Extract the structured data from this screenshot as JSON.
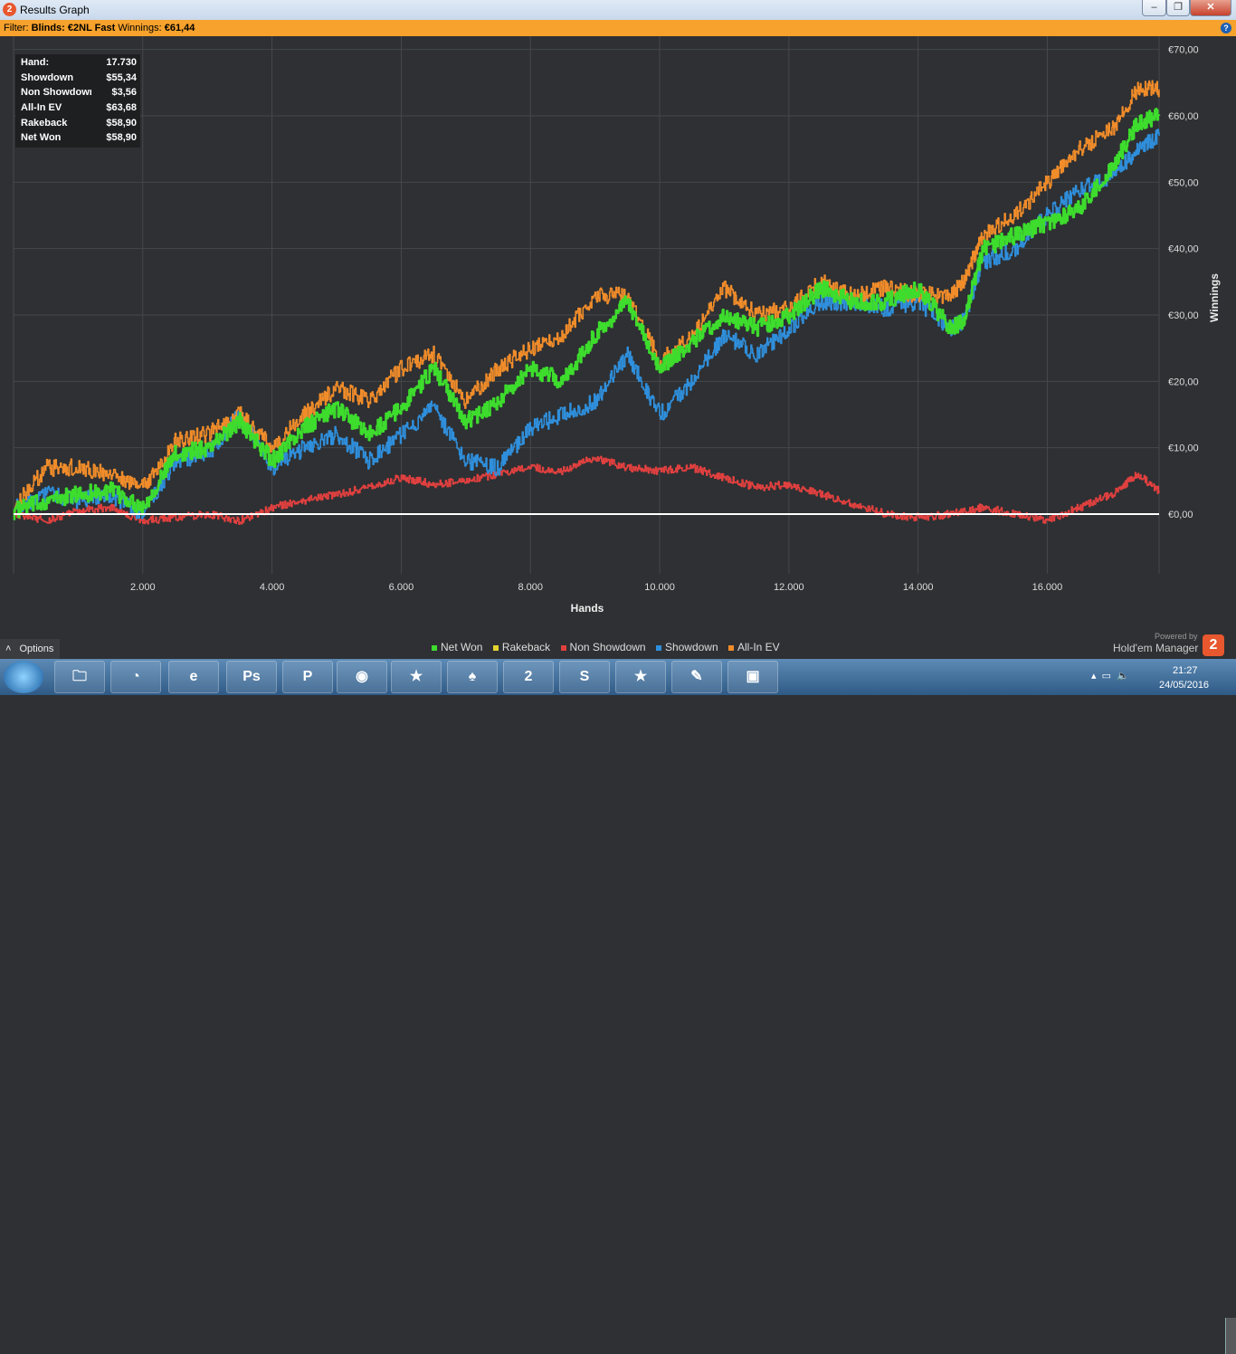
{
  "window": {
    "title": "Results Graph",
    "app_icon_text": "2",
    "controls": {
      "min": "–",
      "max": "❐",
      "close": "✕"
    }
  },
  "filter": {
    "prefix": "Filter:",
    "blinds": "Blinds: €2NL Fast",
    "winnings_label": "Winnings:",
    "winnings_value": "€61,44",
    "help": "?"
  },
  "stats": [
    {
      "label": "Hand:",
      "value": "17.730"
    },
    {
      "label": "Showdown",
      "value": "$55,34"
    },
    {
      "label": "Non Showdown",
      "value": "$3,56"
    },
    {
      "label": "All-In EV",
      "value": "$63,68"
    },
    {
      "label": "Rakeback",
      "value": "$58,90"
    },
    {
      "label": "Net Won",
      "value": "$58,90"
    }
  ],
  "colors": {
    "background": "#2e3033",
    "grid": "#45484c",
    "net_won": "#3ddc2d",
    "rakeback": "#e3d330",
    "non_showdown": "#e0403f",
    "showdown": "#2f8fdc",
    "all_in_ev": "#f08c2a",
    "zero_line": "#ffffff"
  },
  "chart_data": {
    "type": "line",
    "xlabel": "Hands",
    "ylabel": "Winnings",
    "xlim": [
      0,
      17730
    ],
    "ylim": [
      -9,
      72
    ],
    "x_ticks": [
      {
        "v": 2000,
        "label": "2.000"
      },
      {
        "v": 4000,
        "label": "4.000"
      },
      {
        "v": 6000,
        "label": "6.000"
      },
      {
        "v": 8000,
        "label": "8.000"
      },
      {
        "v": 10000,
        "label": "10.000"
      },
      {
        "v": 12000,
        "label": "12.000"
      },
      {
        "v": 14000,
        "label": "14.000"
      },
      {
        "v": 16000,
        "label": "16.000"
      }
    ],
    "y_ticks": [
      {
        "v": 0,
        "label": "€0,00"
      },
      {
        "v": 10,
        "label": "€10,00"
      },
      {
        "v": 20,
        "label": "€20,00"
      },
      {
        "v": 30,
        "label": "€30,00"
      },
      {
        "v": 40,
        "label": "€40,00"
      },
      {
        "v": 50,
        "label": "€50,00"
      },
      {
        "v": 60,
        "label": "€60,00"
      },
      {
        "v": 70,
        "label": "€70,00"
      }
    ],
    "grid": true,
    "series": [
      {
        "name": "Net Won",
        "color": "#3ddc2d",
        "x": [
          0,
          500,
          1000,
          1500,
          2000,
          2500,
          3000,
          3500,
          4000,
          4500,
          5000,
          5500,
          6000,
          6500,
          7000,
          7500,
          8000,
          8500,
          9000,
          9500,
          10000,
          10500,
          11000,
          11500,
          12000,
          12500,
          13000,
          13500,
          14000,
          14500,
          14700,
          15000,
          15500,
          16000,
          16500,
          17000,
          17400,
          17730
        ],
        "y": [
          0.5,
          2,
          3,
          3.5,
          1,
          9,
          10,
          14,
          8,
          13,
          16,
          12,
          16,
          22,
          14,
          17,
          22,
          20,
          27,
          32,
          22,
          26,
          30,
          28,
          30,
          34,
          32,
          32,
          34,
          28,
          29,
          40,
          42,
          44,
          46,
          52,
          59,
          60
        ]
      },
      {
        "name": "Rakeback",
        "color": "#e3d330",
        "x": [
          0,
          17730
        ],
        "y": [
          0,
          0
        ]
      },
      {
        "name": "Non Showdown",
        "color": "#e0403f",
        "x": [
          0,
          500,
          1000,
          1500,
          2000,
          2500,
          3000,
          3500,
          4000,
          4500,
          5000,
          5500,
          6000,
          6500,
          7000,
          7500,
          8000,
          8500,
          9000,
          9500,
          10000,
          10500,
          11000,
          11500,
          12000,
          12500,
          13000,
          13500,
          14000,
          14500,
          15000,
          15500,
          16000,
          16500,
          17000,
          17400,
          17730
        ],
        "y": [
          0,
          -1,
          0.5,
          1,
          -1,
          -0.5,
          0,
          -1,
          1,
          2,
          3,
          4,
          5.5,
          4.5,
          5,
          6,
          7,
          6.5,
          8.5,
          7,
          6.5,
          7,
          5.5,
          4,
          4.5,
          3,
          1.5,
          0,
          -0.5,
          0,
          1,
          0,
          -1,
          1,
          3,
          6,
          3.5
        ]
      },
      {
        "name": "Showdown",
        "color": "#2f8fdc",
        "x": [
          0,
          500,
          1000,
          1500,
          2000,
          2500,
          3000,
          3500,
          4000,
          4500,
          5000,
          5500,
          6000,
          6500,
          7000,
          7500,
          8000,
          8500,
          9000,
          9500,
          10000,
          10500,
          11000,
          11500,
          12000,
          12500,
          13000,
          13500,
          14000,
          14500,
          14700,
          15000,
          15500,
          16000,
          16500,
          17000,
          17400,
          17730
        ],
        "y": [
          1,
          3,
          2,
          3,
          0,
          8,
          9,
          15,
          7,
          10,
          12,
          8,
          12,
          16,
          8,
          7,
          13,
          15,
          17,
          24,
          15,
          20,
          27,
          24,
          28,
          32,
          32,
          31,
          32,
          28,
          29,
          38,
          40,
          45,
          49,
          51,
          55,
          57
        ]
      },
      {
        "name": "All-In EV",
        "color": "#f08c2a",
        "x": [
          0,
          500,
          1000,
          1500,
          2000,
          2500,
          3000,
          3500,
          4000,
          4500,
          5000,
          5500,
          6000,
          6500,
          7000,
          7500,
          8000,
          8500,
          9000,
          9500,
          10000,
          10500,
          11000,
          11500,
          12000,
          12500,
          13000,
          13500,
          14000,
          14500,
          14700,
          15000,
          15500,
          16000,
          16500,
          17000,
          17400,
          17730
        ],
        "y": [
          1,
          7,
          7,
          6,
          4,
          11,
          12,
          15,
          10,
          15,
          19,
          17,
          22,
          24,
          17,
          22,
          25,
          27,
          33,
          33,
          23,
          27,
          34,
          30,
          31,
          35,
          33,
          34,
          33,
          33,
          35,
          42,
          45,
          50,
          55,
          58,
          64,
          64
        ]
      }
    ]
  },
  "footer": {
    "options_label": "Options",
    "options_arrow": "˄",
    "legend": [
      {
        "label": "Net Won",
        "color": "#3ddc2d"
      },
      {
        "label": "Rakeback",
        "color": "#e3d330"
      },
      {
        "label": "Non Showdown",
        "color": "#e0403f"
      },
      {
        "label": "Showdown",
        "color": "#2f8fdc"
      },
      {
        "label": "All-In EV",
        "color": "#f08c2a"
      }
    ],
    "powered_by": "Powered by",
    "brand": "Hold'em Manager",
    "brand_logo": "2"
  },
  "taskbar": {
    "apps": [
      {
        "name": "explorer",
        "glyph": "🗀"
      },
      {
        "name": "blender",
        "glyph": "◔"
      },
      {
        "name": "internet-explorer",
        "glyph": "e"
      },
      {
        "name": "photoshop",
        "glyph": "Ps"
      },
      {
        "name": "pokerx",
        "glyph": "P"
      },
      {
        "name": "chrome",
        "glyph": "◉"
      },
      {
        "name": "pokerstars",
        "glyph": "★"
      },
      {
        "name": "poker-app",
        "glyph": "♠"
      },
      {
        "name": "holdem-manager",
        "glyph": "2"
      },
      {
        "name": "skype",
        "glyph": "S"
      },
      {
        "name": "pokerstars-2",
        "glyph": "★"
      },
      {
        "name": "notes",
        "glyph": "✎"
      },
      {
        "name": "photos",
        "glyph": "▣"
      }
    ],
    "time": "21:27",
    "date": "24/05/2016"
  }
}
